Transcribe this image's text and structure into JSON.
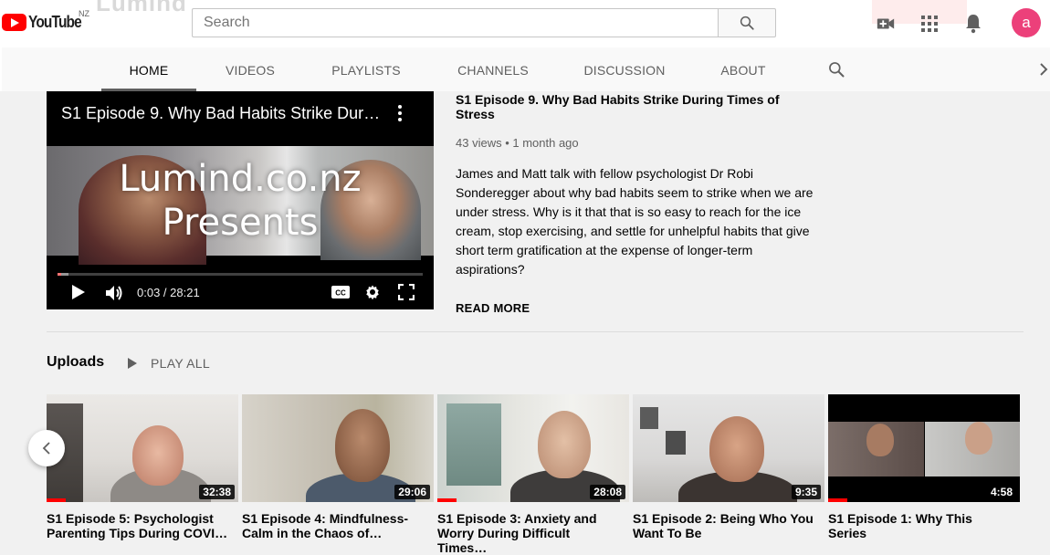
{
  "header": {
    "logo_text": "YouTube",
    "country_code": "NZ",
    "search_placeholder": "Search"
  },
  "avatar_letter": "a",
  "tabs": [
    {
      "label": "HOME",
      "active": true
    },
    {
      "label": "VIDEOS",
      "active": false
    },
    {
      "label": "PLAYLISTS",
      "active": false
    },
    {
      "label": "CHANNELS",
      "active": false
    },
    {
      "label": "DISCUSSION",
      "active": false
    },
    {
      "label": "ABOUT",
      "active": false
    }
  ],
  "featured": {
    "player_title": "S1 Episode 9. Why Bad Habits Strike Duri...",
    "overlay_line1": "Lumind.co.nz",
    "overlay_line2": "Presents",
    "time": "0:03 / 28:21",
    "progress": 0.002,
    "title": "S1 Episode 9. Why Bad Habits Strike During Times of Stress",
    "meta": "43 views • 1 month ago",
    "description": "James and Matt talk with fellow psychologist Dr Robi Sonderegger about why bad habits seem to strike when we are under stress. Why is it that that is so easy to reach for the ice cream, stop exercising, and settle for unhelpful habits that give short term gratification at the expense of longer-term aspirations?",
    "read_more": "READ MORE"
  },
  "uploads": {
    "title": "Uploads",
    "play_all": "PLAY ALL",
    "videos": [
      {
        "title": "S1 Episode 5: Psychologist Parenting Tips During COVI…",
        "duration": "32:38",
        "watched": 0.1
      },
      {
        "title": "S1 Episode 4: Mindfulness-Calm in the Chaos of…",
        "duration": "29:06",
        "watched": 0
      },
      {
        "title": "S1 Episode 3: Anxiety and Worry During Difficult Times…",
        "duration": "28:08",
        "watched": 0.1
      },
      {
        "title": "S1 Episode 2: Being Who You Want To Be",
        "duration": "9:35",
        "watched": 0
      },
      {
        "title": "S1 Episode 1: Why This Series",
        "duration": "4:58",
        "watched": 0.1
      }
    ]
  },
  "colors": {
    "brand_red": "#ff0000",
    "avatar_bg": "#ec407a"
  }
}
